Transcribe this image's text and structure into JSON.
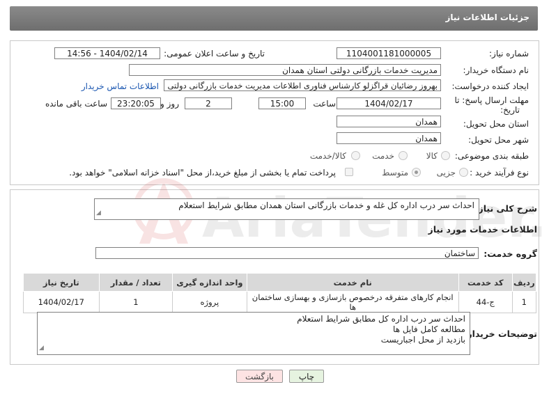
{
  "header": {
    "title": "جزئیات اطلاعات نیاز"
  },
  "form": {
    "need_number_label": "شماره نیاز:",
    "need_number": "1104001181000005",
    "announce_label": "تاریخ و ساعت اعلان عمومی:",
    "announce_value": "1404/02/14 - 14:56",
    "buyer_org_label": "نام دستگاه خریدار:",
    "buyer_org": "مدیریت خدمات بازرگانی دولتی استان همدان",
    "creator_label": "ایجاد کننده درخواست:",
    "creator": "بهروز رضائیان قراگزلو کارشناس فناوری اطلاعات مدیریت خدمات بازرگانی دولتی ا",
    "contact_link": "اطلاعات تماس خریدار",
    "deadline_label_1": "مهلت ارسال پاسخ: تا",
    "deadline_label_2": "تاریخ:",
    "deadline_date": "1404/02/17",
    "time_label": "ساعت",
    "deadline_time": "15:00",
    "days_value": "2",
    "days_label": "روز و",
    "remaining_time": "23:20:05",
    "remaining_label": "ساعت باقی مانده",
    "province_label": "استان محل تحویل:",
    "province": "همدان",
    "city_label": "شهر محل تحویل:",
    "city": "همدان",
    "category_label": "طبقه بندی موضوعی:",
    "category_options": [
      "کالا",
      "خدمت",
      "کالا/خدمت"
    ],
    "category_selected": "",
    "purchase_type_label": "نوع فرآیند خرید :",
    "purchase_options": [
      "جزیی",
      "متوسط"
    ],
    "purchase_selected": "متوسط",
    "payment_note": "پرداخت تمام یا بخشی از مبلغ خرید،از محل \"اسناد خزانه اسلامی\" خواهد بود."
  },
  "summary": {
    "label": "شرح کلی نیاز:",
    "text": "احداث سر درب اداره کل غله و خدمات بازرگانی استان همدان مطابق شرایط استعلام"
  },
  "services": {
    "section_title": "اطلاعات خدمات مورد نیاز",
    "group_label": "گروه خدمت:",
    "group_value": "ساختمان",
    "columns": [
      "ردیف",
      "کد خدمت",
      "نام خدمت",
      "واحد اندازه گیری",
      "تعداد / مقدار",
      "تاریخ نیاز"
    ],
    "rows": [
      [
        "1",
        "ج-44",
        "انجام کارهای متفرقه درخصوص بازسازی و بهسازی ساختمان ها",
        "پروژه",
        "1",
        "1404/02/17"
      ]
    ]
  },
  "buyer_notes": {
    "label": "توضیحات خریدار:",
    "lines": [
      "احداث سر درب اداره کل مطابق شرایط استعلام",
      "مطالعه کامل فایل ها",
      "بازدید از محل اجباریست"
    ]
  },
  "buttons": {
    "print": "چاپ",
    "back": "بازگشت"
  },
  "colors": {
    "header": "#7a7a7a",
    "back_button_bg": "#fde3e3",
    "print_button_bg": "#e6f3e0",
    "link": "#1a56b0"
  },
  "watermark": {
    "text": "AriaTender.net"
  }
}
